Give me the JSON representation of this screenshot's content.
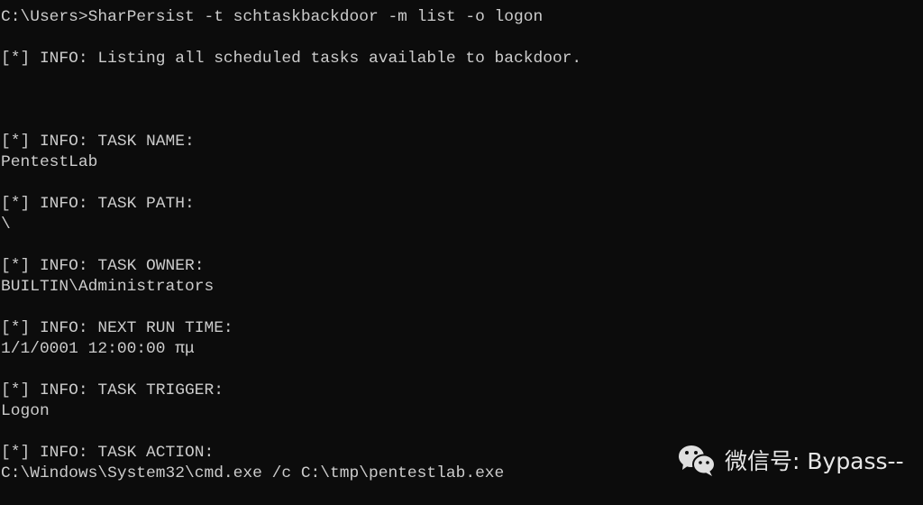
{
  "terminal": {
    "lines": [
      "C:\\Users>SharPersist -t schtaskbackdoor -m list -o logon",
      "",
      "[*] INFO: Listing all scheduled tasks available to backdoor.",
      "",
      "",
      "",
      "[*] INFO: TASK NAME:",
      "PentestLab",
      "",
      "[*] INFO: TASK PATH:",
      "\\",
      "",
      "[*] INFO: TASK OWNER:",
      "BUILTIN\\Administrators",
      "",
      "[*] INFO: NEXT RUN TIME:",
      "1/1/0001 12:00:00 πμ",
      "",
      "[*] INFO: TASK TRIGGER:",
      "Logon",
      "",
      "[*] INFO: TASK ACTION:",
      "C:\\Windows\\System32\\cmd.exe /c C:\\tmp\\pentestlab.exe"
    ]
  },
  "watermark": {
    "icon": "wechat-icon",
    "text": "微信号: Bypass--"
  },
  "colors": {
    "background": "#0c0c0c",
    "text": "#cccccc"
  }
}
